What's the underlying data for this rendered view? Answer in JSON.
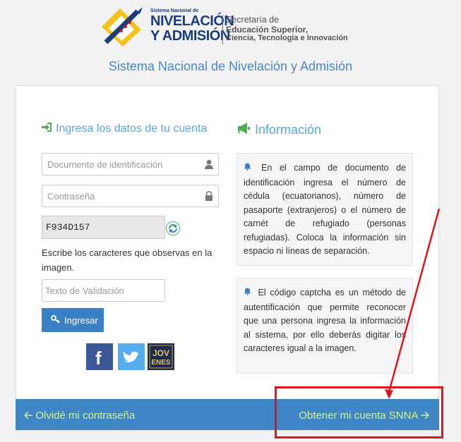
{
  "header": {
    "logo_small": "Sistema Nacional de",
    "logo_line1": "NIVELACIÓN",
    "logo_line2": "Y ADMISIÓN",
    "sec_line1": "Secretaría de",
    "sec_line2": "Educación Superior,",
    "sec_line3": "Ciencia, Tecnología e Innovación"
  },
  "system_title": "Sistema Nacional de Nivelación y Admisión",
  "login": {
    "heading": "Ingresa los datos de tu cuenta",
    "document_placeholder": "Documento de identificación",
    "password_placeholder": "Contraseña",
    "captcha_code": "F934D157",
    "captcha_help": "Escribe los caracteres que observas en la imagen.",
    "validation_placeholder": "Texto de Validación",
    "submit_label": "Ingresar"
  },
  "social": {
    "facebook": "f",
    "jovenes_top": "JOV",
    "jovenes_bottom": "ENES"
  },
  "info": {
    "heading": "Información",
    "box1": "En el campo de documento de identificación ingresa el número de cédula (ecuatorianos), número de pasaporte (extranjeros) o el número de carnét de refugiado (personas refugiadas). Coloca la información sin espacio ni líneas de separación.",
    "box2": "El código captcha es un método de autentificación que permite reconocer que una persona ingresa la información al sistema, por ello deberás digitar los caracteres igual a la imagen."
  },
  "footer": {
    "forgot_password": "Olvidé mi contraseña",
    "get_account": "Obtener mi cuenta SNNA"
  },
  "colors": {
    "accent_blue": "#3a80c4",
    "footer_link": "#d4f18a",
    "annotation_red": "#e0151b"
  }
}
